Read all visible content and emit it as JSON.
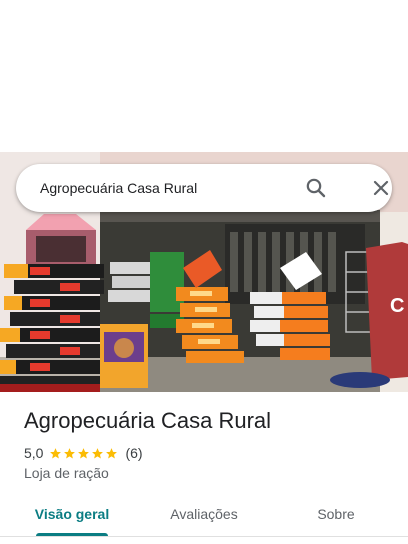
{
  "search": {
    "query": "Agropecuária Casa Rural"
  },
  "icons": {
    "search": "search-icon",
    "close": "close-icon",
    "star": "star-icon"
  },
  "place": {
    "name": "Agropecuária Casa Rural",
    "rating": "5,0",
    "stars": 5,
    "review_count": "(6)",
    "category": "Loja de ração"
  },
  "tabs": [
    {
      "label": "Visão geral",
      "active": true
    },
    {
      "label": "Avaliações",
      "active": false
    },
    {
      "label": "Sobre",
      "active": false
    }
  ],
  "colors": {
    "accent": "#0b7d83",
    "star": "#fbbc04",
    "title": "#202124",
    "muted": "#5f6368"
  }
}
